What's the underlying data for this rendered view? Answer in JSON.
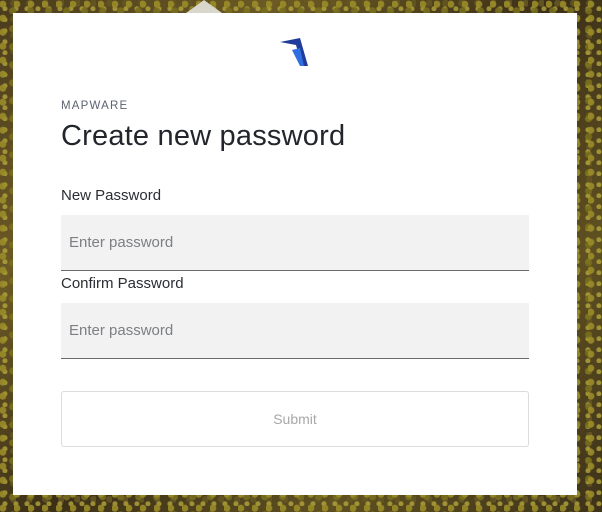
{
  "brand": {
    "name": "MAPWARE",
    "logo_icon": "chevron-logo-icon",
    "logo_colors": [
      "#1f3c9c",
      "#2f6fe0"
    ]
  },
  "page": {
    "title": "Create new password"
  },
  "form": {
    "new_password": {
      "label": "New Password",
      "placeholder": "Enter password",
      "value": ""
    },
    "confirm_password": {
      "label": "Confirm Password",
      "placeholder": "Enter password",
      "value": ""
    },
    "submit_label": "Submit",
    "submit_state": "disabled"
  }
}
